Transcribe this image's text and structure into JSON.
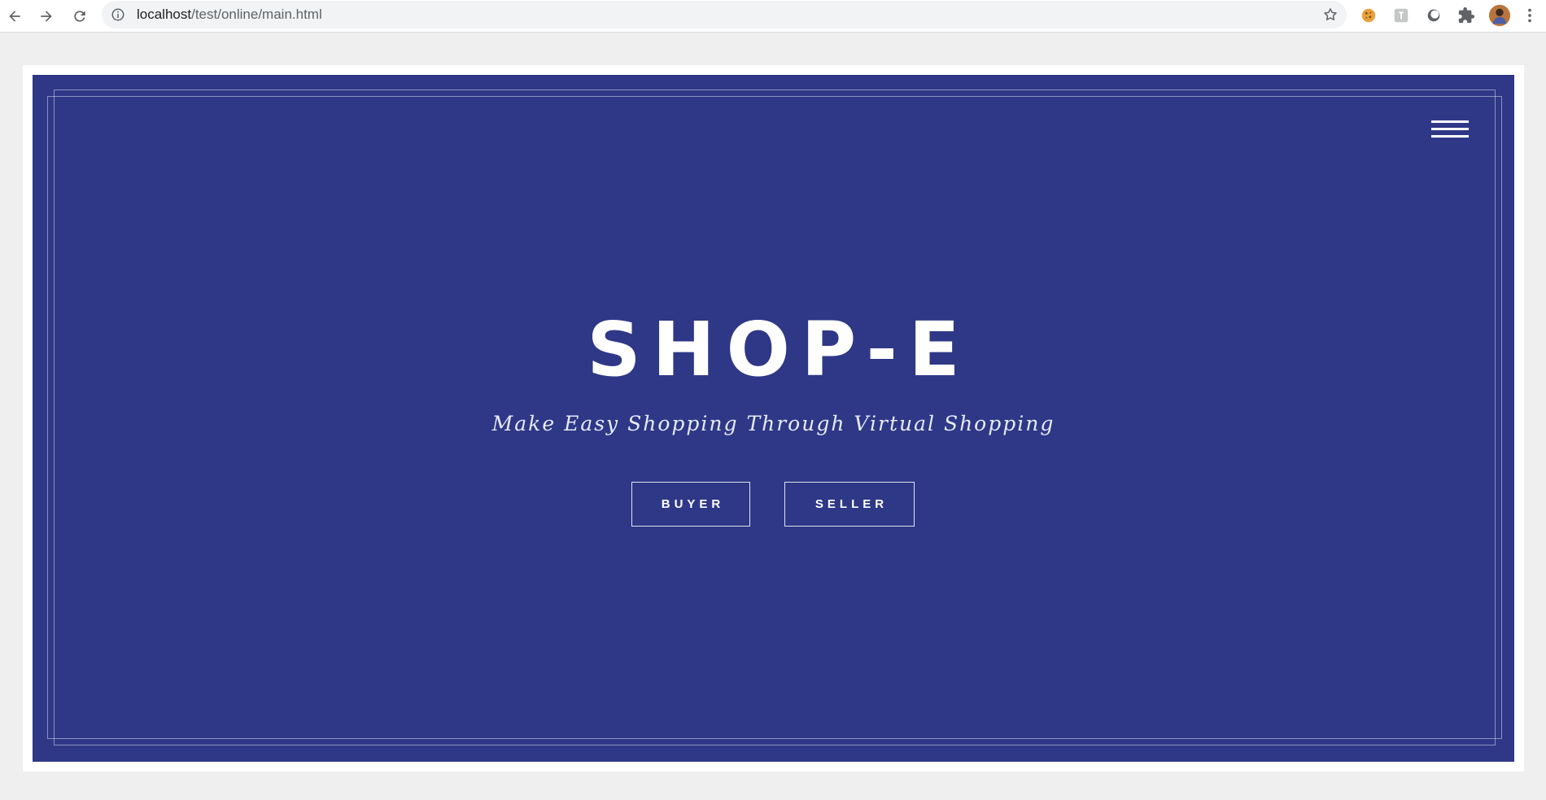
{
  "browser": {
    "url_host": "localhost",
    "url_path": "/test/online/main.html",
    "back_label": "Back",
    "forward_label": "Forward",
    "reload_label": "Reload"
  },
  "hero": {
    "title": "SHOP-E",
    "tagline": "Make Easy Shopping Through Virtual Shopping",
    "buttons": {
      "buyer": "BUYER",
      "seller": "SELLER"
    },
    "menu_icon": "hamburger-menu-icon"
  },
  "colors": {
    "hero_background": "#2e3887",
    "page_background": "#efefef",
    "text": "#ffffff"
  }
}
